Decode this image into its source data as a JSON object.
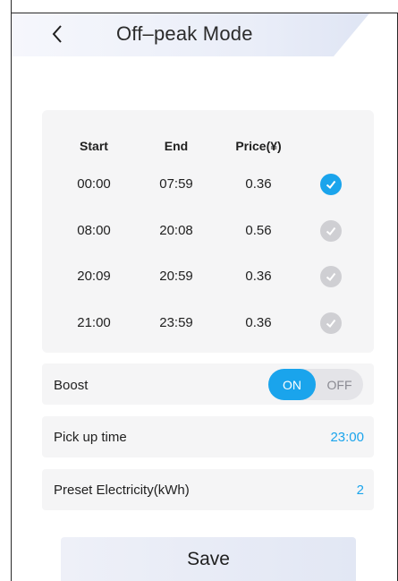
{
  "header": {
    "title": "Off–peak Mode",
    "back_icon": "chevron-left-icon"
  },
  "table": {
    "headers": {
      "start": "Start",
      "end": "End",
      "price": "Price(¥)"
    },
    "rows": [
      {
        "start": "00:00",
        "end": "07:59",
        "price": "0.36",
        "selected": true
      },
      {
        "start": "08:00",
        "end": "20:08",
        "price": "0.56",
        "selected": false
      },
      {
        "start": "20:09",
        "end": "20:59",
        "price": "0.36",
        "selected": false
      },
      {
        "start": "21:00",
        "end": "23:59",
        "price": "0.36",
        "selected": false
      }
    ]
  },
  "boost": {
    "label": "Boost",
    "on_label": "ON",
    "off_label": "OFF",
    "state": "ON"
  },
  "pickup": {
    "label": "Pick up time",
    "value": "23:00"
  },
  "preset": {
    "label": "Preset Electricity(kWh)",
    "value": "2"
  },
  "save": {
    "label": "Save"
  },
  "colors": {
    "accent": "#1aa4ec",
    "inactive_check": "#cfcfd3",
    "card_bg": "#f5f5f6"
  }
}
